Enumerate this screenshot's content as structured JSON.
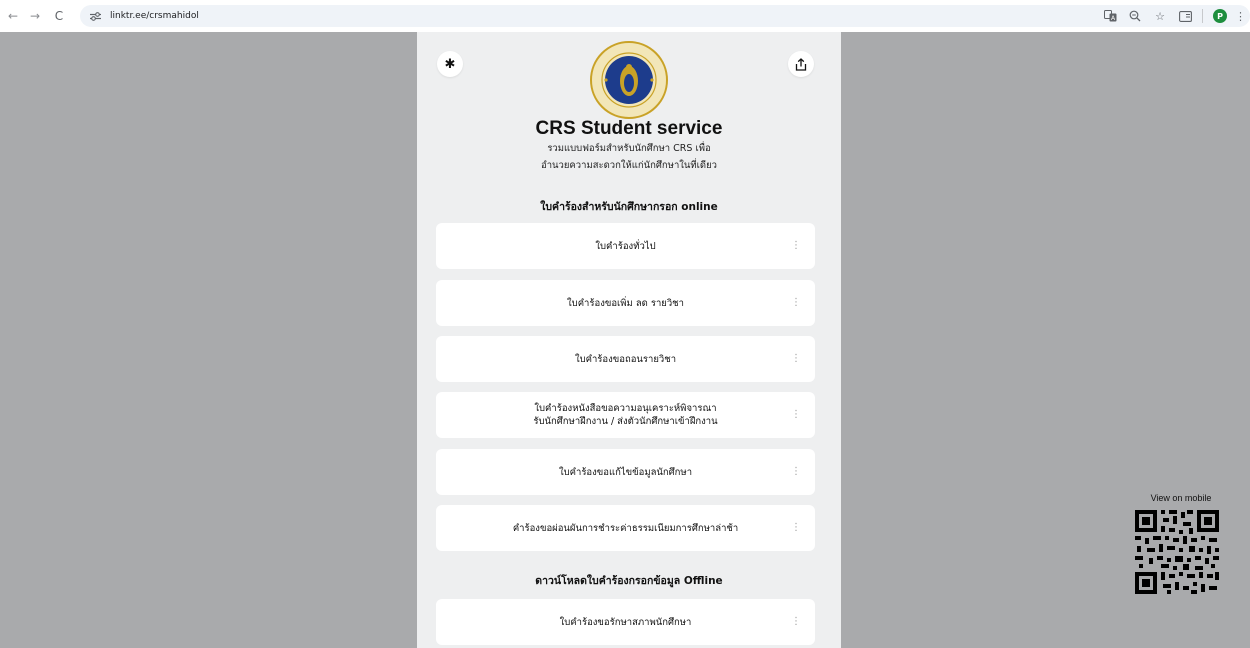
{
  "browser": {
    "url": "linktr.ee/crsmahidol",
    "back_icon": "←",
    "forward_icon": "→",
    "reload_icon": "C",
    "profile_initial": "P"
  },
  "profile": {
    "title": "CRS Student service",
    "description_line1": "รวมแบบฟอร์มสำหรับนักศึกษา CRS เพื่อ",
    "description_line2": "อำนวยความสะดวกให้แก่นักศึกษาในที่เดียว"
  },
  "sections": {
    "online_heading": "ใบคำร้องสำหรับนักศึกษากรอก online",
    "offline_heading": "ดาวน์โหลดใบคำร้องกรอกข้อมูล Offline"
  },
  "links": [
    {
      "line1": "ใบคำร้องทั่วไป",
      "line2": ""
    },
    {
      "line1": "ใบคำร้องขอเพิ่ม ลด รายวิชา",
      "line2": ""
    },
    {
      "line1": "ใบคำร้องขอถอนรายวิชา",
      "line2": ""
    },
    {
      "line1": "ใบคำร้องหนังสือขอความอนุเคราะห์พิจารณา",
      "line2": "รับนักศึกษาฝึกงาน / ส่งตัวนักศึกษาเข้าฝึกงาน"
    },
    {
      "line1": "ใบคำร้องขอแก้ไขข้อมูลนักศึกษา",
      "line2": ""
    },
    {
      "line1": "คำร้องขอผ่อนผันการชำระค่าธรรมเนียมการศึกษาล่าช้า",
      "line2": ""
    },
    {
      "line1": "ใบคำร้องขอรักษาสภาพนักศึกษา",
      "line2": ""
    }
  ],
  "qr": {
    "label": "View on mobile"
  },
  "colors": {
    "backdrop": "#a9aaac",
    "card_column": "#eeeff0",
    "logo_blue": "#1d3c8c",
    "logo_gold": "#c9a227",
    "profile_green": "#1e8e3e"
  }
}
